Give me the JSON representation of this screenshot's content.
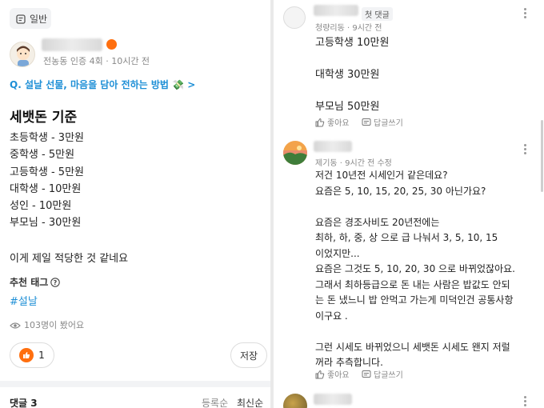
{
  "left": {
    "category_chip": "일반",
    "author": {
      "meta": "전농동 인증 4회 · 10시간 전"
    },
    "question_link": "Q. 설날 선물, 마음을 담아 전하는 방법 💸 >",
    "post": {
      "title": "세뱃돈 기준",
      "lines": [
        "초등학생 - 3만원",
        "중학생 - 5만원",
        "고등학생 - 5만원",
        "대학생 - 10만원",
        "성인 - 10만원",
        "부모님 - 30만원"
      ],
      "closing": "이게 제일 적당한 것 같네요"
    },
    "tags": {
      "label": "추천 태그",
      "items": [
        "#설날"
      ]
    },
    "views": "103명이 봤어요",
    "like_count": "1",
    "save_label": "저장",
    "comments_header": {
      "label": "댓글 3",
      "sort_options": [
        "등록순",
        "최신순"
      ]
    }
  },
  "right": {
    "comments": [
      {
        "badge": "첫 댓글",
        "meta": "청량리동 · 9시간 전",
        "lines": [
          "고등학생 10만원",
          "",
          "대학생 30만원",
          "",
          "부모님 50만원"
        ],
        "like_label": "좋아요",
        "reply_label": "답글쓰기"
      },
      {
        "meta": "제기동 · 9시간 전 수정",
        "lines": [
          "저건 10년전 시세인거 같은데요?",
          "요즘은 5, 10, 15, 20, 25, 30 아닌가요?",
          "",
          "요즘은 경조사비도 20년전에는",
          "최하, 하, 중, 상 으로 급 나눠서 3, 5, 10, 15",
          "이었지만...",
          "요즘은 그것도 5, 10, 20, 30 으로 바뀌었잖아요.",
          "그래서 최하등급으로 돈 내는 사람은 밥값도 안되",
          "는 돈 냈느니 밥 안먹고 가는게 미덕인건 공통사항",
          "이구요 .",
          "",
          "그런 시세도 바뀌었으니 세뱃돈 시세도 왠지 저럴",
          "꺼라 추측합니다."
        ],
        "like_label": "좋아요",
        "reply_label": "답글쓰기"
      }
    ]
  },
  "colors": {
    "accent_blue": "#1e8fd6",
    "badge_orange": "#ff6f0f",
    "muted": "#888888"
  }
}
